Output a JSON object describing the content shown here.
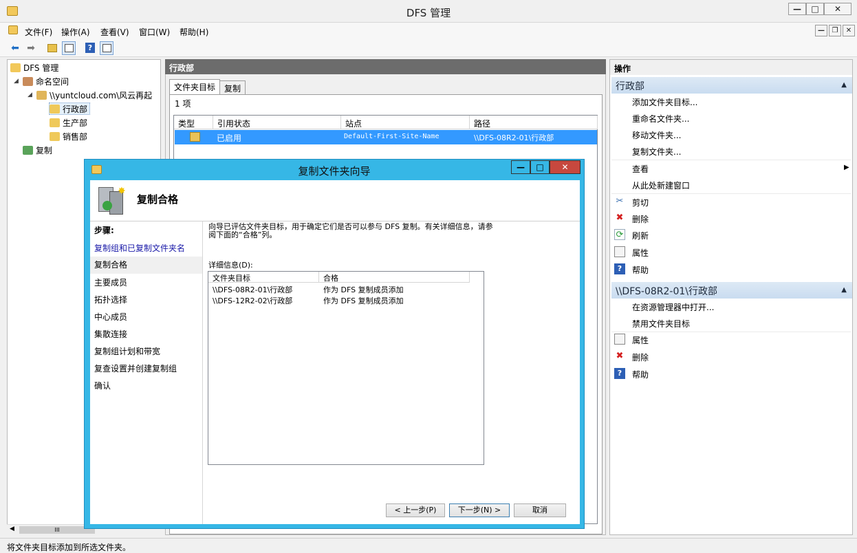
{
  "window": {
    "title": "DFS 管理",
    "controls": [
      "—",
      "□",
      "✕"
    ]
  },
  "menu": [
    "文件(F)",
    "操作(A)",
    "查看(V)",
    "窗口(W)",
    "帮助(H)"
  ],
  "mdi_controls": [
    "—",
    "❐",
    "✕"
  ],
  "tree": {
    "root": "DFS 管理",
    "namespace": "命名空间",
    "ns_path": "\\\\yuntcloud.com\\风云再起",
    "folders": [
      "行政部",
      "生产部",
      "销售部"
    ],
    "replication": "复制",
    "scroll_grip": "III"
  },
  "center": {
    "header": "行政部",
    "tabs": [
      "文件夹目标",
      "复制"
    ],
    "count": "1 项",
    "columns": [
      "类型",
      "引用状态",
      "站点",
      "路径"
    ],
    "rows": [
      {
        "status": "已启用",
        "site": "Default-First-Site-Name",
        "path": "\\\\DFS-08R2-01\\行政部"
      }
    ]
  },
  "actions": {
    "title": "操作",
    "group1": "行政部",
    "group1_items": [
      "添加文件夹目标...",
      "重命名文件夹...",
      "移动文件夹...",
      "复制文件夹...",
      "查看",
      "从此处新建窗口",
      "剪切",
      "删除",
      "刷新",
      "属性",
      "帮助"
    ],
    "group2": "\\\\DFS-08R2-01\\行政部",
    "group2_items": [
      "在资源管理器中打开...",
      "禁用文件夹目标",
      "属性",
      "删除",
      "帮助"
    ]
  },
  "status": "将文件夹目标添加到所选文件夹。",
  "dialog": {
    "title": "复制文件夹向导",
    "header_title": "复制合格",
    "steps_label": "步骤:",
    "steps": [
      "复制组和已复制文件夹名",
      "复制合格",
      "主要成员",
      "拓扑选择",
      "中心成员",
      "集散连接",
      "复制组计划和带宽",
      "复查设置并创建复制组",
      "确认"
    ],
    "description": "向导已评估文件夹目标，用于确定它们是否可以参与 DFS 复制。有关详细信息，请参阅下面的“合格”列。",
    "details_label": "详细信息(D):",
    "details_columns": [
      "文件夹目标",
      "合格"
    ],
    "details_rows": [
      {
        "target": "\\\\DFS-08R2-01\\行政部",
        "eligible": "作为 DFS 复制成员添加"
      },
      {
        "target": "\\\\DFS-12R2-02\\行政部",
        "eligible": "作为 DFS 复制成员添加"
      }
    ],
    "buttons": {
      "back": "< 上一步(P)",
      "next": "下一步(N) >",
      "cancel": "取消"
    },
    "controls": [
      "—",
      "□",
      "✕"
    ]
  }
}
